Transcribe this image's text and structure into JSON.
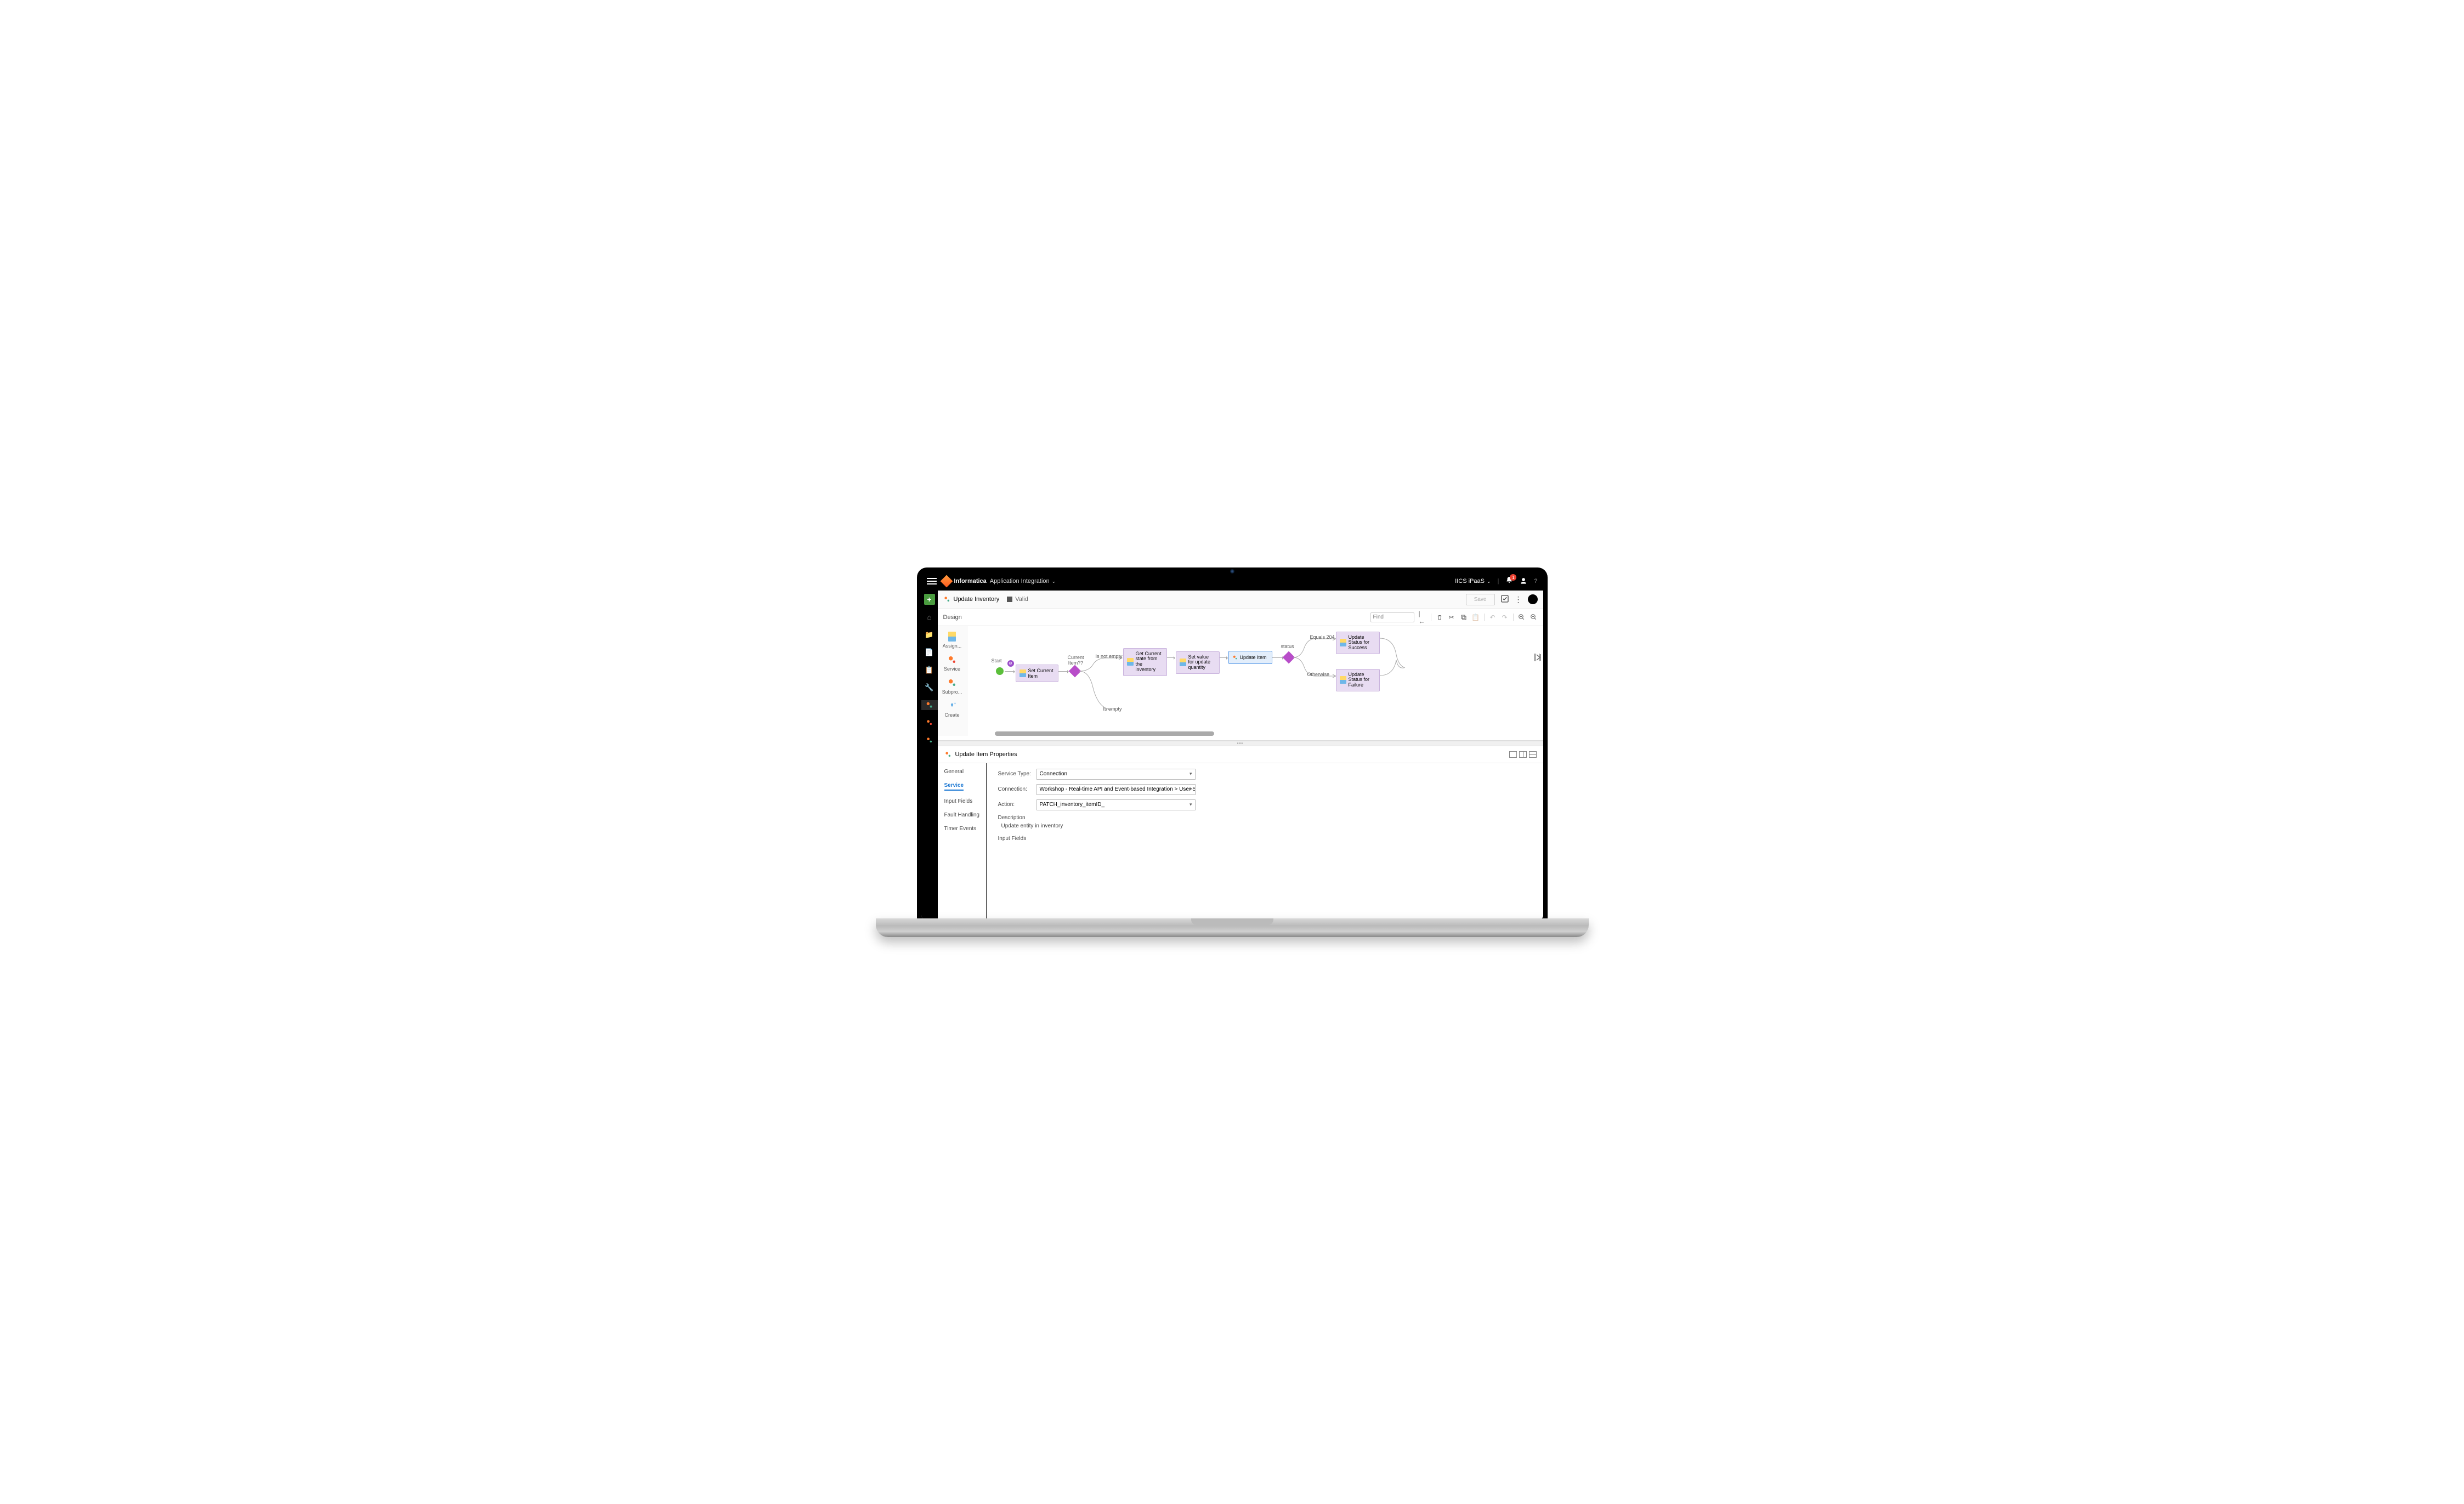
{
  "topbar": {
    "brand": "Informatica",
    "app": "Application Integration",
    "tenant": "IICS iPaaS",
    "notif_count": "1"
  },
  "leftnav": {
    "items": [
      "home",
      "folder",
      "data",
      "doc",
      "tools",
      "process",
      "process2",
      "process3"
    ]
  },
  "tab": {
    "title": "Update Inventory",
    "status": "Valid",
    "save_label": "Save"
  },
  "design": {
    "label": "Design",
    "find_placeholder": "Find",
    "palette": [
      {
        "label": "Assign..."
      },
      {
        "label": "Service"
      },
      {
        "label": "Subpro..."
      },
      {
        "label": "Create"
      }
    ],
    "nodes": {
      "start": "Start",
      "set_current": "Set Current Item",
      "decision1": "Current Item??",
      "branch_notempty": "Is not empty",
      "branch_empty": "Is empty",
      "get_state": "Get Current state from the inventory",
      "set_value": "Set value for update quantity",
      "update_item": "Update Item",
      "decision2": "status",
      "branch_204": "Equals 204",
      "branch_otherwise": "Otherwise",
      "update_success": "Update Status for Success",
      "update_failure": "Update Status for Failure"
    }
  },
  "props": {
    "title": "Update Item Properties",
    "tabs": {
      "general": "General",
      "service": "Service",
      "input_fields": "Input Fields",
      "fault_handling": "Fault Handling",
      "timer_events": "Timer Events"
    },
    "form": {
      "service_type_label": "Service Type:",
      "service_type_value": "Connection",
      "connection_label": "Connection:",
      "connection_value": "Workshop - Real-time API and Event-based Integration > User Services > Inventory-Data-S",
      "action_label": "Action:",
      "action_value": "PATCH_inventory_itemID_",
      "description_label": "Description",
      "description_value": "Update entity in inventory",
      "input_fields_label": "Input Fields"
    }
  }
}
